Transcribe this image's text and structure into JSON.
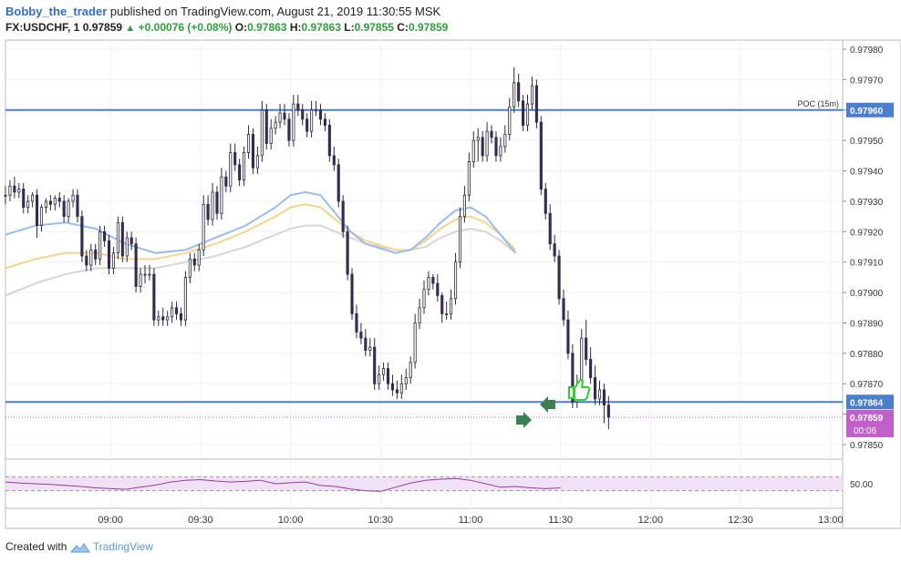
{
  "header": {
    "author": "Bobby_the_trader",
    "published_text": "published on TradingView.com, August 21, 2019 11:30:55 MSK",
    "symbol": "FX:USDCHF, 1",
    "last": "0.97859",
    "change": "+0.00076 (+0.08%)",
    "o_label": "O:",
    "o_value": "0.97863",
    "h_label": "H:",
    "h_value": "0.97863",
    "l_label": "L:",
    "l_value": "0.97855",
    "c_label": "C:",
    "c_value": "0.97859"
  },
  "footer": {
    "created_with": "Created with",
    "brand": "TradingView"
  },
  "colors": {
    "candle_up": "#ffffff",
    "candle_down": "#3a2a5c",
    "wick": "#2a2a40",
    "hline": "#4a7fd0",
    "ema_fast": "#9bbcea",
    "ema_mid": "#f2d58e",
    "ema_slow": "#d6d6d6",
    "rsi": "#9a3aa0",
    "rsi_band": "#f1e1f6",
    "last_price_tag": "#c060c8",
    "green_arrow": "#3a8050"
  },
  "icons": [
    "thumbs-up-icon",
    "green-arrow-right-icon",
    "green-arrow-left-icon",
    "tradingview-logo-icon"
  ],
  "chart_data": {
    "type": "candlestick",
    "y_axis_ticks": [
      "0.97980",
      "0.97970",
      "0.97960",
      "0.97950",
      "0.97940",
      "0.97930",
      "0.97920",
      "0.97910",
      "0.97900",
      "0.97890",
      "0.97880",
      "0.97870",
      "0.97860",
      "0.97850"
    ],
    "ylim": [
      0.97847,
      0.97983
    ],
    "x_axis_ticks": [
      "09:00",
      "09:30",
      "10:00",
      "10:30",
      "11:00",
      "11:30",
      "12:00",
      "12:30",
      "13:00"
    ],
    "x_start_minutes": 505,
    "x_end_minutes": 784,
    "horizontal_lines": [
      {
        "label": "POC (15m)",
        "value": 0.9796,
        "price_tag": "0.97960"
      },
      {
        "value": 0.97864,
        "price_tag": "0.97864"
      }
    ],
    "last_price": {
      "value": 0.97859,
      "price_tag": "0.97859",
      "countdown": "00:06"
    },
    "candles": {
      "start_minute": 505,
      "close": [
        0.97932,
        0.97935,
        0.97933,
        0.97934,
        0.97928,
        0.9793,
        0.97932,
        0.97922,
        0.97928,
        0.9793,
        0.97929,
        0.97931,
        0.9793,
        0.97925,
        0.9793,
        0.97932,
        0.97925,
        0.97912,
        0.97909,
        0.97914,
        0.97911,
        0.9792,
        0.97917,
        0.97908,
        0.97913,
        0.97923,
        0.97912,
        0.97918,
        0.97916,
        0.97902,
        0.97906,
        0.97906,
        0.97906,
        0.97891,
        0.97892,
        0.97891,
        0.97892,
        0.97895,
        0.97893,
        0.97891,
        0.97905,
        0.97911,
        0.97909,
        0.97914,
        0.97929,
        0.97924,
        0.97933,
        0.97926,
        0.97938,
        0.97935,
        0.97946,
        0.97942,
        0.97937,
        0.97946,
        0.97952,
        0.97941,
        0.97945,
        0.9796,
        0.97949,
        0.97954,
        0.97956,
        0.97959,
        0.97957,
        0.9795,
        0.97962,
        0.9796,
        0.97957,
        0.97953,
        0.9796,
        0.9796,
        0.97957,
        0.97955,
        0.97945,
        0.97942,
        0.9793,
        0.9792,
        0.97906,
        0.97893,
        0.97887,
        0.97885,
        0.97881,
        0.97882,
        0.9787,
        0.97873,
        0.97875,
        0.9787,
        0.97868,
        0.97867,
        0.9787,
        0.97872,
        0.97877,
        0.9789,
        0.97895,
        0.97901,
        0.97905,
        0.97903,
        0.97899,
        0.97893,
        0.97893,
        0.97898,
        0.9791,
        0.97925,
        0.97932,
        0.97943,
        0.9795,
        0.97951,
        0.97945,
        0.97953,
        0.97951,
        0.97945,
        0.97948,
        0.97952,
        0.97961,
        0.97969,
        0.97963,
        0.97955,
        0.97962,
        0.97968,
        0.97956,
        0.97934,
        0.97926,
        0.97916,
        0.97912,
        0.97898,
        0.97891,
        0.9788,
        0.97864,
        0.97869,
        0.97885,
        0.97878,
        0.97872,
        0.97865,
        0.97868,
        0.97863,
        0.97859
      ],
      "open": [
        0.97932,
        0.97932,
        0.97935,
        0.97933,
        0.97934,
        0.97928,
        0.9793,
        0.97932,
        0.97922,
        0.97928,
        0.9793,
        0.97929,
        0.97931,
        0.9793,
        0.97925,
        0.9793,
        0.97932,
        0.97925,
        0.97912,
        0.97909,
        0.97914,
        0.97911,
        0.9792,
        0.97917,
        0.97908,
        0.97913,
        0.97923,
        0.97912,
        0.97918,
        0.97916,
        0.97902,
        0.97906,
        0.97906,
        0.97906,
        0.97891,
        0.97892,
        0.97891,
        0.97892,
        0.97895,
        0.97893,
        0.97891,
        0.97905,
        0.97911,
        0.97909,
        0.97914,
        0.97929,
        0.97924,
        0.97933,
        0.97926,
        0.97938,
        0.97935,
        0.97946,
        0.97942,
        0.97937,
        0.97946,
        0.97952,
        0.97941,
        0.97945,
        0.9796,
        0.97949,
        0.97954,
        0.97956,
        0.97959,
        0.97957,
        0.9795,
        0.97962,
        0.9796,
        0.97957,
        0.97953,
        0.9796,
        0.9796,
        0.97957,
        0.97955,
        0.97945,
        0.97942,
        0.9793,
        0.9792,
        0.97906,
        0.97893,
        0.97887,
        0.97885,
        0.97881,
        0.97882,
        0.9787,
        0.97873,
        0.97875,
        0.9787,
        0.97868,
        0.97867,
        0.9787,
        0.97872,
        0.97877,
        0.9789,
        0.97895,
        0.97901,
        0.97905,
        0.97903,
        0.97899,
        0.97893,
        0.97893,
        0.97898,
        0.9791,
        0.97925,
        0.97932,
        0.97943,
        0.9795,
        0.97951,
        0.97945,
        0.97953,
        0.97951,
        0.97945,
        0.97948,
        0.97952,
        0.97961,
        0.97969,
        0.97963,
        0.97955,
        0.97962,
        0.97968,
        0.97956,
        0.97934,
        0.97926,
        0.97916,
        0.97912,
        0.97898,
        0.97891,
        0.9788,
        0.97864,
        0.97869,
        0.97885,
        0.97878,
        0.97872,
        0.97865,
        0.97868,
        0.97863
      ],
      "high": [
        0.97935,
        0.97937,
        0.97938,
        0.97936,
        0.97936,
        0.97932,
        0.97933,
        0.97934,
        0.97929,
        0.97931,
        0.97932,
        0.97932,
        0.97933,
        0.97932,
        0.97931,
        0.97934,
        0.97934,
        0.97927,
        0.97914,
        0.97916,
        0.97916,
        0.97922,
        0.97922,
        0.97919,
        0.97915,
        0.97925,
        0.97925,
        0.9792,
        0.9792,
        0.97918,
        0.97908,
        0.97909,
        0.97909,
        0.97908,
        0.97894,
        0.97895,
        0.97894,
        0.97897,
        0.97897,
        0.97895,
        0.97907,
        0.97913,
        0.97913,
        0.97916,
        0.97932,
        0.97932,
        0.97936,
        0.97935,
        0.97941,
        0.9794,
        0.97949,
        0.97949,
        0.97944,
        0.97948,
        0.97955,
        0.97954,
        0.97948,
        0.97963,
        0.97962,
        0.97957,
        0.97958,
        0.97962,
        0.97962,
        0.97959,
        0.97965,
        0.97965,
        0.97962,
        0.97959,
        0.97963,
        0.97963,
        0.97962,
        0.97959,
        0.97957,
        0.97948,
        0.97944,
        0.97932,
        0.97922,
        0.97908,
        0.97896,
        0.9789,
        0.97888,
        0.97885,
        0.97885,
        0.97876,
        0.97877,
        0.97877,
        0.97873,
        0.97871,
        0.97873,
        0.97875,
        0.97879,
        0.97893,
        0.97898,
        0.97904,
        0.97907,
        0.97906,
        0.97906,
        0.979,
        0.97897,
        0.97901,
        0.97913,
        0.97928,
        0.97935,
        0.97946,
        0.97953,
        0.97954,
        0.97953,
        0.97956,
        0.97955,
        0.97953,
        0.97951,
        0.97955,
        0.97964,
        0.97974,
        0.97972,
        0.97965,
        0.97965,
        0.97971,
        0.9797,
        0.97958,
        0.97936,
        0.97929,
        0.97919,
        0.97914,
        0.97901,
        0.97894,
        0.97883,
        0.97873,
        0.97888,
        0.97891,
        0.97882,
        0.97876,
        0.97871,
        0.9787,
        0.97866
      ],
      "low": [
        0.97929,
        0.9793,
        0.97931,
        0.97931,
        0.97926,
        0.97926,
        0.97928,
        0.97918,
        0.9792,
        0.97926,
        0.97927,
        0.97927,
        0.97928,
        0.97923,
        0.97923,
        0.97928,
        0.97923,
        0.9791,
        0.97907,
        0.97907,
        0.97909,
        0.97909,
        0.97915,
        0.97906,
        0.97906,
        0.97911,
        0.9791,
        0.9791,
        0.97914,
        0.979,
        0.979,
        0.97903,
        0.97904,
        0.97889,
        0.97889,
        0.97889,
        0.97889,
        0.9789,
        0.97891,
        0.97889,
        0.97889,
        0.97903,
        0.97907,
        0.97907,
        0.97912,
        0.97922,
        0.97922,
        0.97924,
        0.97924,
        0.97933,
        0.97933,
        0.9794,
        0.97935,
        0.97935,
        0.97944,
        0.97939,
        0.97939,
        0.97943,
        0.97947,
        0.97947,
        0.97952,
        0.97954,
        0.97955,
        0.97948,
        0.97948,
        0.97958,
        0.97955,
        0.97951,
        0.97951,
        0.97958,
        0.97955,
        0.97953,
        0.97943,
        0.9794,
        0.97928,
        0.97918,
        0.97904,
        0.97891,
        0.97885,
        0.97883,
        0.97879,
        0.97879,
        0.97868,
        0.97868,
        0.97871,
        0.97868,
        0.97866,
        0.97865,
        0.97865,
        0.97868,
        0.9787,
        0.97875,
        0.97888,
        0.97893,
        0.97899,
        0.97901,
        0.97897,
        0.9789,
        0.97891,
        0.97891,
        0.97896,
        0.97908,
        0.97923,
        0.9793,
        0.97941,
        0.97943,
        0.97943,
        0.97943,
        0.97949,
        0.97943,
        0.97943,
        0.97946,
        0.9795,
        0.97959,
        0.97961,
        0.97953,
        0.97953,
        0.9796,
        0.97954,
        0.97932,
        0.97924,
        0.97914,
        0.9791,
        0.97896,
        0.97889,
        0.97878,
        0.97862,
        0.97862,
        0.97867,
        0.97876,
        0.9787,
        0.97863,
        0.97863,
        0.97857,
        0.97855
      ]
    },
    "moving_averages": [
      {
        "color_key": "ema_fast",
        "points": [
          [
            505,
            0.97919
          ],
          [
            515,
            0.97922
          ],
          [
            525,
            0.97923
          ],
          [
            535,
            0.97921
          ],
          [
            545,
            0.97916
          ],
          [
            555,
            0.97913
          ],
          [
            565,
            0.97914
          ],
          [
            575,
            0.97918
          ],
          [
            585,
            0.97922
          ],
          [
            595,
            0.97928
          ],
          [
            600,
            0.97932
          ],
          [
            605,
            0.97933
          ],
          [
            610,
            0.97932
          ],
          [
            615,
            0.97926
          ],
          [
            620,
            0.9792
          ],
          [
            625,
            0.97916
          ],
          [
            635,
            0.97913
          ],
          [
            640,
            0.97914
          ],
          [
            645,
            0.97918
          ],
          [
            650,
            0.97923
          ],
          [
            655,
            0.97927
          ],
          [
            660,
            0.97928
          ],
          [
            665,
            0.97925
          ],
          [
            670,
            0.97919
          ],
          [
            675,
            0.97913
          ]
        ]
      },
      {
        "color_key": "ema_mid",
        "points": [
          [
            505,
            0.97908
          ],
          [
            515,
            0.97911
          ],
          [
            525,
            0.97913
          ],
          [
            535,
            0.97913
          ],
          [
            545,
            0.97911
          ],
          [
            555,
            0.97911
          ],
          [
            565,
            0.97913
          ],
          [
            575,
            0.97916
          ],
          [
            585,
            0.9792
          ],
          [
            595,
            0.97925
          ],
          [
            600,
            0.97928
          ],
          [
            605,
            0.97929
          ],
          [
            610,
            0.97928
          ],
          [
            615,
            0.97924
          ],
          [
            620,
            0.9792
          ],
          [
            625,
            0.97917
          ],
          [
            635,
            0.97914
          ],
          [
            640,
            0.97914
          ],
          [
            645,
            0.97917
          ],
          [
            650,
            0.97921
          ],
          [
            655,
            0.97924
          ],
          [
            660,
            0.97925
          ],
          [
            665,
            0.97923
          ],
          [
            670,
            0.97919
          ],
          [
            675,
            0.97914
          ]
        ]
      },
      {
        "color_key": "ema_slow",
        "points": [
          [
            505,
            0.97899
          ],
          [
            515,
            0.97903
          ],
          [
            525,
            0.97906
          ],
          [
            535,
            0.97908
          ],
          [
            545,
            0.97908
          ],
          [
            555,
            0.97908
          ],
          [
            565,
            0.9791
          ],
          [
            575,
            0.97912
          ],
          [
            585,
            0.97915
          ],
          [
            595,
            0.97919
          ],
          [
            600,
            0.97921
          ],
          [
            605,
            0.97922
          ],
          [
            610,
            0.97922
          ],
          [
            615,
            0.9792
          ],
          [
            620,
            0.97918
          ],
          [
            625,
            0.97916
          ],
          [
            635,
            0.97914
          ],
          [
            640,
            0.97914
          ],
          [
            645,
            0.97915
          ],
          [
            650,
            0.97918
          ],
          [
            655,
            0.9792
          ],
          [
            660,
            0.97921
          ],
          [
            665,
            0.9792
          ],
          [
            670,
            0.97917
          ],
          [
            675,
            0.97913
          ]
        ]
      }
    ],
    "rsi": {
      "tick_label": "50.00",
      "band": [
        30,
        70
      ],
      "ylim": [
        0,
        100
      ],
      "points": [
        [
          505,
          55
        ],
        [
          510,
          52
        ],
        [
          515,
          50
        ],
        [
          520,
          48
        ],
        [
          525,
          45
        ],
        [
          530,
          42
        ],
        [
          535,
          38
        ],
        [
          540,
          36
        ],
        [
          545,
          34
        ],
        [
          550,
          40
        ],
        [
          555,
          46
        ],
        [
          560,
          55
        ],
        [
          565,
          60
        ],
        [
          570,
          62
        ],
        [
          575,
          58
        ],
        [
          580,
          55
        ],
        [
          585,
          57
        ],
        [
          590,
          60
        ],
        [
          595,
          50
        ],
        [
          600,
          53
        ],
        [
          605,
          55
        ],
        [
          610,
          45
        ],
        [
          615,
          42
        ],
        [
          620,
          35
        ],
        [
          625,
          30
        ],
        [
          630,
          28
        ],
        [
          635,
          40
        ],
        [
          640,
          52
        ],
        [
          645,
          60
        ],
        [
          650,
          63
        ],
        [
          655,
          65
        ],
        [
          660,
          60
        ],
        [
          665,
          50
        ],
        [
          670,
          40
        ],
        [
          675,
          42
        ],
        [
          680,
          38
        ],
        [
          685,
          36
        ],
        [
          690,
          38
        ]
      ]
    }
  }
}
